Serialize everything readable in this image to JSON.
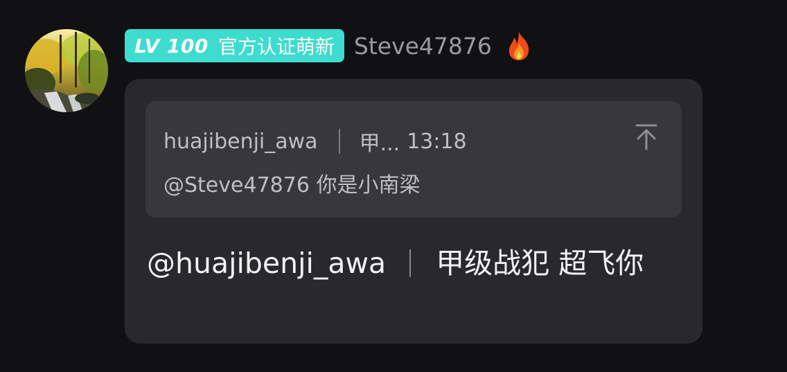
{
  "sender": {
    "avatar_icon": "forest-waterfall-avatar",
    "badge": {
      "level": "LV 100",
      "title": "官方认证萌新",
      "color": "#3ddccf"
    },
    "username": "Steve47876",
    "status_icon": "fire-icon"
  },
  "reply": {
    "quoted": {
      "author": "huajibenji_awa",
      "title": "甲...",
      "time": "13:18",
      "text": "@Steve47876 你是小南梁",
      "jump_icon": "scroll-to-top-icon"
    },
    "message": {
      "mention": "@huajibenji_awa",
      "title": "甲级战犯",
      "text": "超飞你"
    }
  }
}
